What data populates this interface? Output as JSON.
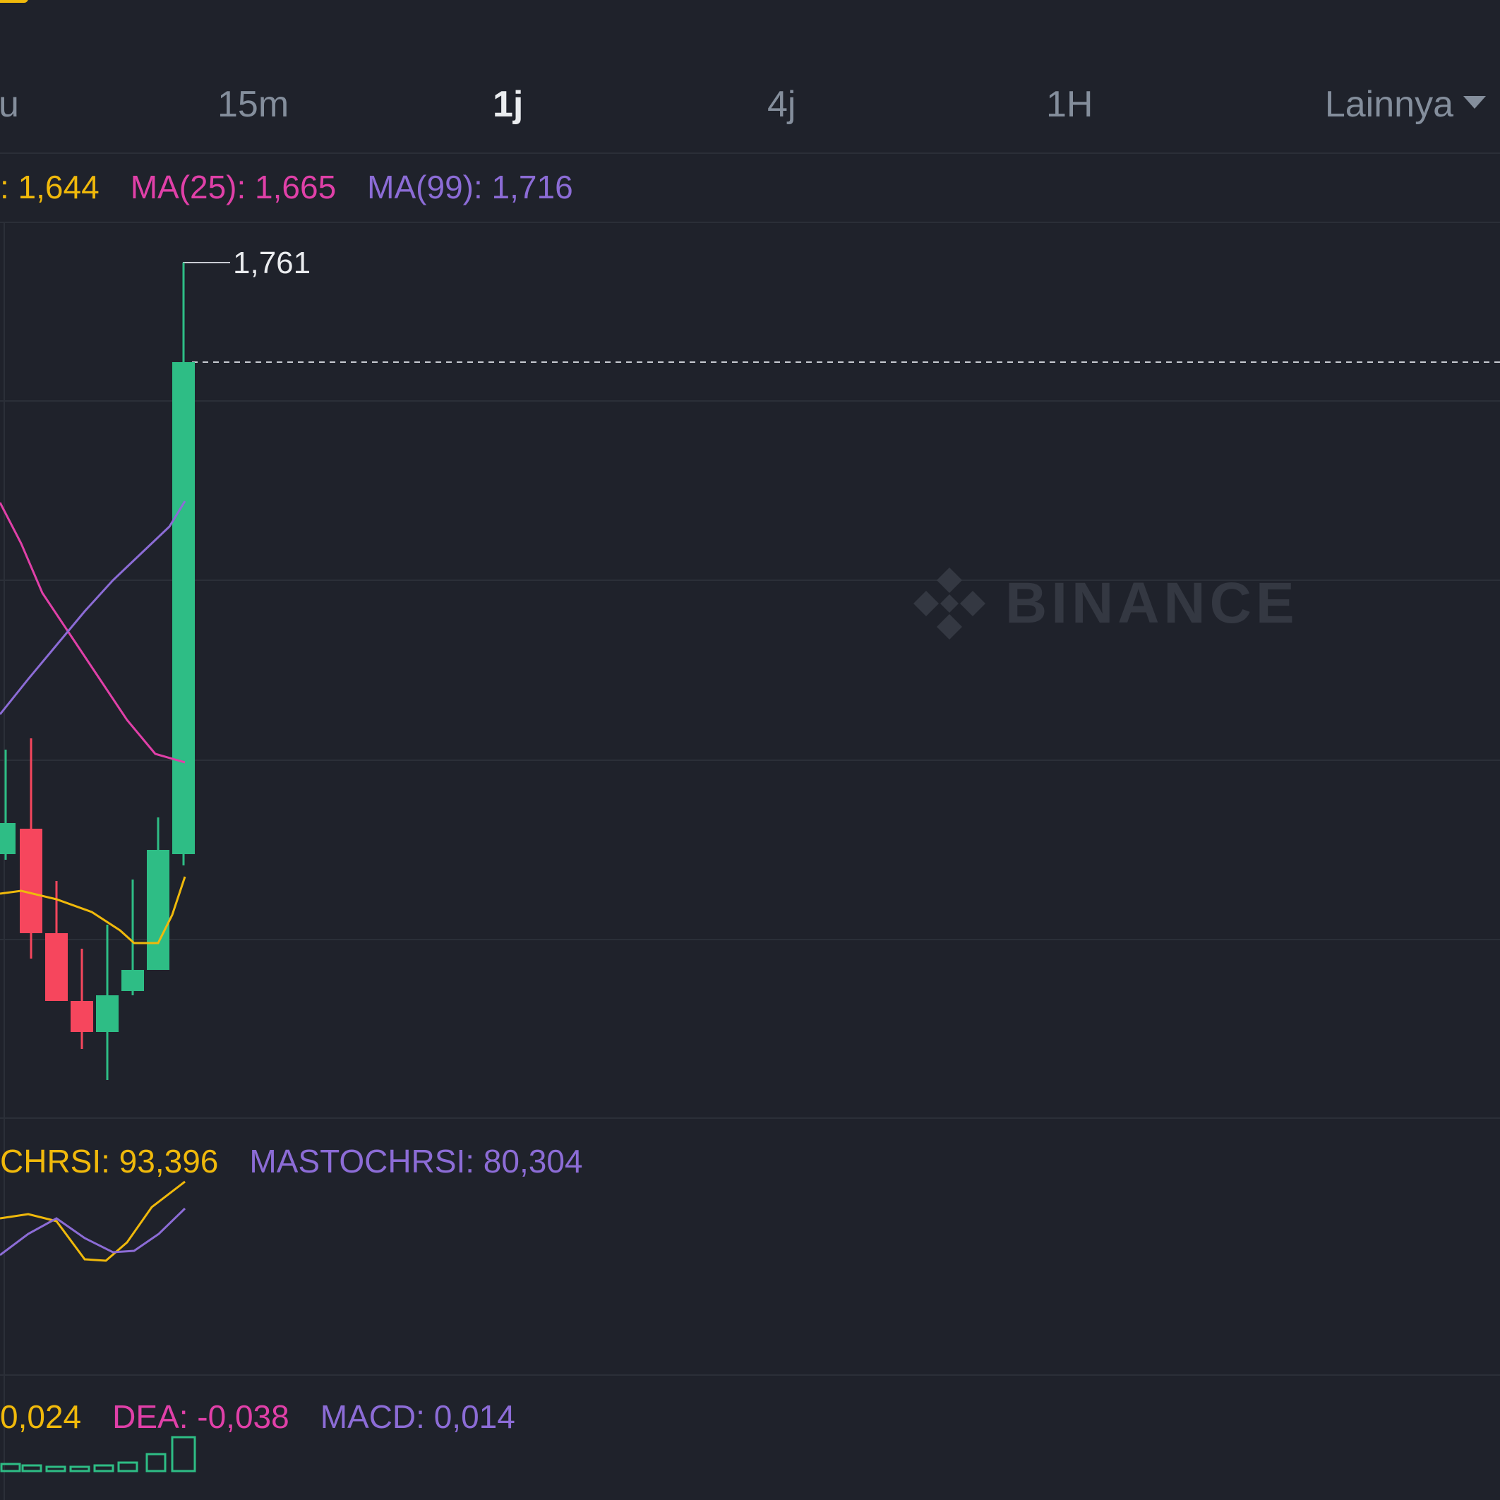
{
  "intervals": {
    "partial": "u",
    "items": [
      "15m",
      "1j",
      "4j",
      "1H"
    ],
    "active": "1j",
    "more_label": "Lainnya"
  },
  "ma_legend": {
    "ma7": ": 1,644",
    "ma25": "MA(25): 1,665",
    "ma99": "MA(99): 1,716"
  },
  "price_chart": {
    "high_label": "1,761",
    "watermark": "BINANCE"
  },
  "stochrsi_legend": {
    "stochrsi": "CHRSI: 93,396",
    "mastochrsi": "MASTOCHRSI: 80,304"
  },
  "macd_legend": {
    "dif": "0,024",
    "dea": "DEA: -0,038",
    "macd": "MACD: 0,014"
  },
  "colors": {
    "up": "#2ebd85",
    "down": "#f6465d",
    "ma7": "#f0b90b",
    "ma25": "#e040a8",
    "ma99": "#8c6cd6",
    "background": "#1f222b"
  }
}
